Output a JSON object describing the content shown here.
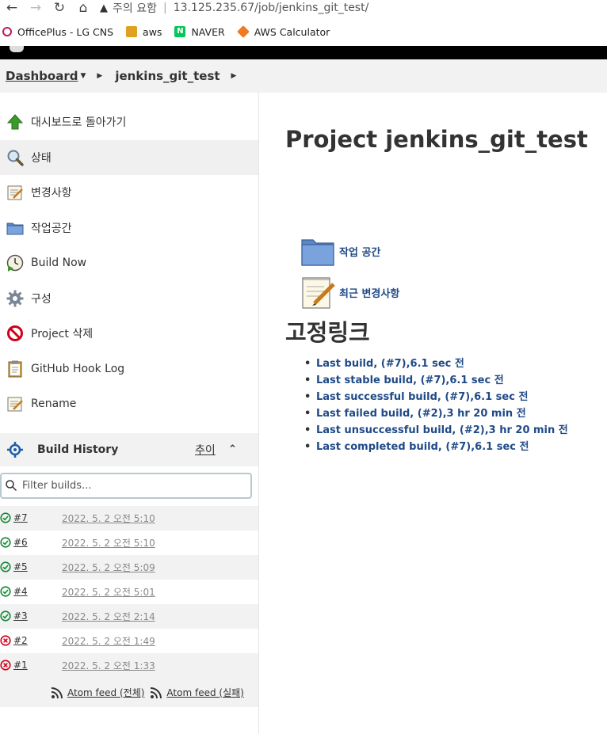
{
  "browser": {
    "security_label": "주의 요함",
    "url": "13.125.235.67/job/jenkins_git_test/",
    "bookmarks": [
      {
        "label": "OfficePlus - LG CNS",
        "icon": "officeplus-icon"
      },
      {
        "label": "aws",
        "icon": "aws-folder-icon"
      },
      {
        "label": "NAVER",
        "icon": "naver-icon"
      },
      {
        "label": "AWS Calculator",
        "icon": "aws-calculator-icon"
      }
    ]
  },
  "breadcrumb": {
    "dashboard": "Dashboard",
    "job": "jenkins_git_test"
  },
  "sidebar": {
    "tasks": [
      {
        "label": "대시보드로 돌아가기",
        "icon": "up-arrow-icon"
      },
      {
        "label": "상태",
        "icon": "search-icon"
      },
      {
        "label": "변경사항",
        "icon": "notepad-icon"
      },
      {
        "label": "작업공간",
        "icon": "folder-icon"
      },
      {
        "label": "Build Now",
        "icon": "clock-icon"
      },
      {
        "label": "구성",
        "icon": "gear-icon"
      },
      {
        "label": "Project 삭제",
        "icon": "no-entry-icon"
      },
      {
        "label": "GitHub Hook Log",
        "icon": "clipboard-icon"
      },
      {
        "label": "Rename",
        "icon": "notepad-icon"
      }
    ]
  },
  "build_history": {
    "title": "Build History",
    "trend": "추이",
    "filter_placeholder": "Filter builds...",
    "builds": [
      {
        "number": "#7",
        "date": "2022. 5. 2 오전 5:10",
        "status": "success"
      },
      {
        "number": "#6",
        "date": "2022. 5. 2 오전 5:10",
        "status": "success"
      },
      {
        "number": "#5",
        "date": "2022. 5. 2 오전 5:09",
        "status": "success"
      },
      {
        "number": "#4",
        "date": "2022. 5. 2 오전 5:01",
        "status": "success"
      },
      {
        "number": "#3",
        "date": "2022. 5. 2 오전 2:14",
        "status": "success"
      },
      {
        "number": "#2",
        "date": "2022. 5. 2 오전 1:49",
        "status": "failed"
      },
      {
        "number": "#1",
        "date": "2022. 5. 2 오전 1:33",
        "status": "failed"
      }
    ],
    "feed_all": "Atom feed (전체)",
    "feed_failed": "Atom feed (실패)"
  },
  "main": {
    "title": "Project jenkins_git_test",
    "links": [
      {
        "label": "작업 공간",
        "icon": "folder-icon"
      },
      {
        "label": "최근 변경사항",
        "icon": "notepad-icon"
      }
    ],
    "permalinks_title": "고정링크",
    "permalinks": [
      "Last build, (#7),6.1 sec 전",
      "Last stable build, (#7),6.1 sec 전",
      "Last successful build, (#7),6.1 sec 전",
      "Last failed build, (#2),3 hr 20 min 전",
      "Last unsuccessful build, (#2),3 hr 20 min 전",
      "Last completed build, (#7),6.1 sec 전"
    ]
  },
  "colors": {
    "link": "#204a87",
    "success": "#138a36",
    "failure": "#d0021b",
    "header": "#000000"
  }
}
